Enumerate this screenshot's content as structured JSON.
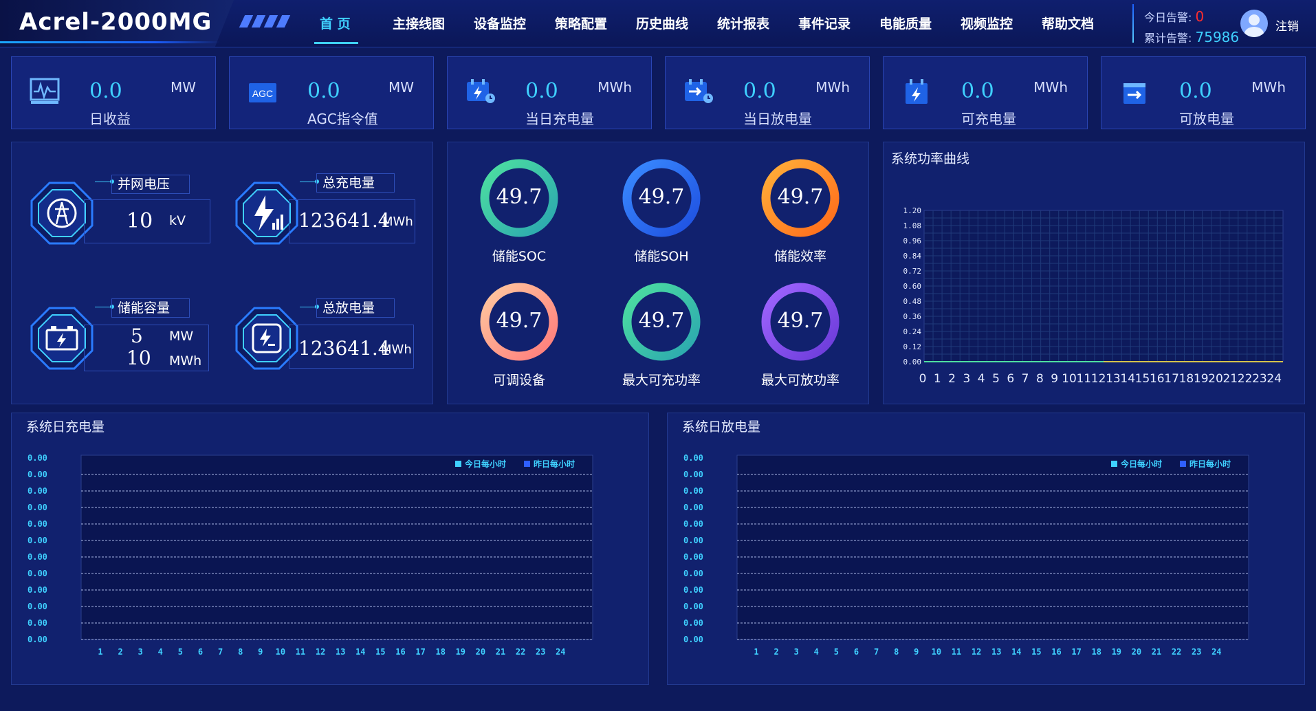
{
  "header": {
    "brand": "Acrel-2000MG",
    "nav": [
      "首 页",
      "主接线图",
      "设备监控",
      "策略配置",
      "历史曲线",
      "统计报表",
      "事件记录",
      "电能质量",
      "视频监控",
      "帮助文档"
    ],
    "active_nav": "首 页",
    "today_alarm_label": "今日告警:",
    "today_alarm_value": "0",
    "total_alarm_label": "累计告警:",
    "total_alarm_value": "75986",
    "logout": "注销"
  },
  "kpis": [
    {
      "value": "0.0",
      "unit": "MW",
      "label": "日收益",
      "icon": "chart-monitor-icon"
    },
    {
      "value": "0.0",
      "unit": "MW",
      "label": "AGC指令值",
      "icon": "agc-icon"
    },
    {
      "value": "0.0",
      "unit": "MWh",
      "label": "当日充电量",
      "icon": "charge-calendar-icon"
    },
    {
      "value": "0.0",
      "unit": "MWh",
      "label": "当日放电量",
      "icon": "discharge-calendar-icon"
    },
    {
      "value": "0.0",
      "unit": "MWh",
      "label": "可充电量",
      "icon": "chargeable-icon"
    },
    {
      "value": "0.0",
      "unit": "MWh",
      "label": "可放电量",
      "icon": "dischargeable-icon"
    }
  ],
  "info": {
    "grid_voltage": {
      "label": "并网电压",
      "value": "10",
      "unit": "kV",
      "icon": "transmission-tower-icon"
    },
    "total_charge": {
      "label": "总充电量",
      "value": "123641.4",
      "unit": "MWh",
      "icon": "lightning-signal-icon"
    },
    "storage_capacity": {
      "label": "储能容量",
      "value1": "5",
      "unit1": "MW",
      "value2": "10",
      "unit2": "MWh",
      "icon": "battery-icon"
    },
    "total_discharge": {
      "label": "总放电量",
      "value": "123641.4",
      "unit": "MWh",
      "icon": "discharge-icon"
    }
  },
  "rings": [
    {
      "value": "49.7",
      "label": "储能SOC",
      "color_a": "#4ee0a0",
      "color_b": "#2aa6b0"
    },
    {
      "value": "49.7",
      "label": "储能SOH",
      "color_a": "#3a8bff",
      "color_b": "#1e4fe0"
    },
    {
      "value": "49.7",
      "label": "储能效率",
      "color_a": "#ffb03a",
      "color_b": "#ff6a1a"
    },
    {
      "value": "49.7",
      "label": "可调设备",
      "color_a": "#ffc9a0",
      "color_b": "#ff7a7a"
    },
    {
      "value": "49.7",
      "label": "最大可充功率",
      "color_a": "#4ee0a0",
      "color_b": "#2aa6b0"
    },
    {
      "value": "49.7",
      "label": "最大可放功率",
      "color_a": "#a066ff",
      "color_b": "#6a3ad8"
    }
  ],
  "power_chart": {
    "title": "系统功率曲线",
    "y_ticks": [
      "1.20",
      "1.08",
      "0.96",
      "0.84",
      "0.72",
      "0.60",
      "0.48",
      "0.36",
      "0.24",
      "0.12",
      "0.00"
    ],
    "x_ticks": [
      "0",
      "1",
      "2",
      "3",
      "4",
      "5",
      "6",
      "7",
      "8",
      "9",
      "10",
      "11",
      "12",
      "13",
      "14",
      "15",
      "16",
      "17",
      "18",
      "19",
      "20",
      "21",
      "22",
      "23",
      "24"
    ]
  },
  "charge_chart": {
    "title": "系统日充电量",
    "legend": [
      "今日每小时",
      "昨日每小时"
    ],
    "y_ticks": [
      "0.00",
      "0.00",
      "0.00",
      "0.00",
      "0.00",
      "0.00",
      "0.00",
      "0.00",
      "0.00",
      "0.00",
      "0.00",
      "0.00"
    ],
    "x_ticks": [
      "1",
      "2",
      "3",
      "4",
      "5",
      "6",
      "7",
      "8",
      "9",
      "10",
      "11",
      "12",
      "13",
      "14",
      "15",
      "16",
      "17",
      "18",
      "19",
      "20",
      "21",
      "22",
      "23",
      "24"
    ]
  },
  "discharge_chart": {
    "title": "系统日放电量",
    "legend": [
      "今日每小时",
      "昨日每小时"
    ],
    "y_ticks": [
      "0.00",
      "0.00",
      "0.00",
      "0.00",
      "0.00",
      "0.00",
      "0.00",
      "0.00",
      "0.00",
      "0.00",
      "0.00",
      "0.00"
    ],
    "x_ticks": [
      "1",
      "2",
      "3",
      "4",
      "5",
      "6",
      "7",
      "8",
      "9",
      "10",
      "11",
      "12",
      "13",
      "14",
      "15",
      "16",
      "17",
      "18",
      "19",
      "20",
      "21",
      "22",
      "23",
      "24"
    ]
  },
  "chart_data": [
    {
      "type": "line",
      "title": "系统功率曲线",
      "x": [
        0,
        1,
        2,
        3,
        4,
        5,
        6,
        7,
        8,
        9,
        10,
        11,
        12,
        13,
        14,
        15,
        16,
        17,
        18,
        19,
        20,
        21,
        22,
        23,
        24
      ],
      "series": [
        {
          "values": [
            0,
            0,
            0,
            0,
            0,
            0,
            0,
            0,
            0,
            0,
            0,
            0,
            0,
            0,
            0,
            0,
            0,
            0,
            0,
            0,
            0,
            0,
            0,
            0,
            0
          ]
        }
      ],
      "ylim": [
        0,
        1.2
      ],
      "grid": true
    },
    {
      "type": "bar",
      "title": "系统日充电量",
      "categories": [
        "1",
        "2",
        "3",
        "4",
        "5",
        "6",
        "7",
        "8",
        "9",
        "10",
        "11",
        "12",
        "13",
        "14",
        "15",
        "16",
        "17",
        "18",
        "19",
        "20",
        "21",
        "22",
        "23",
        "24"
      ],
      "series": [
        {
          "name": "今日每小时",
          "values": [
            0,
            0,
            0,
            0,
            0,
            0,
            0,
            0,
            0,
            0,
            0,
            0,
            0,
            0,
            0,
            0,
            0,
            0,
            0,
            0,
            0,
            0,
            0,
            0
          ]
        },
        {
          "name": "昨日每小时",
          "values": [
            0,
            0,
            0,
            0,
            0,
            0,
            0,
            0,
            0,
            0,
            0,
            0,
            0,
            0,
            0,
            0,
            0,
            0,
            0,
            0,
            0,
            0,
            0,
            0
          ]
        }
      ],
      "legend": "top-right"
    },
    {
      "type": "bar",
      "title": "系统日放电量",
      "categories": [
        "1",
        "2",
        "3",
        "4",
        "5",
        "6",
        "7",
        "8",
        "9",
        "10",
        "11",
        "12",
        "13",
        "14",
        "15",
        "16",
        "17",
        "18",
        "19",
        "20",
        "21",
        "22",
        "23",
        "24"
      ],
      "series": [
        {
          "name": "今日每小时",
          "values": [
            0,
            0,
            0,
            0,
            0,
            0,
            0,
            0,
            0,
            0,
            0,
            0,
            0,
            0,
            0,
            0,
            0,
            0,
            0,
            0,
            0,
            0,
            0,
            0
          ]
        },
        {
          "name": "昨日每小时",
          "values": [
            0,
            0,
            0,
            0,
            0,
            0,
            0,
            0,
            0,
            0,
            0,
            0,
            0,
            0,
            0,
            0,
            0,
            0,
            0,
            0,
            0,
            0,
            0,
            0
          ]
        }
      ],
      "legend": "top-right"
    }
  ],
  "colors": {
    "accent": "#3fd0ff",
    "legend_today": "#3fd0ff",
    "legend_yesterday": "#2f5fff",
    "alarm": "#ff2d2d"
  }
}
